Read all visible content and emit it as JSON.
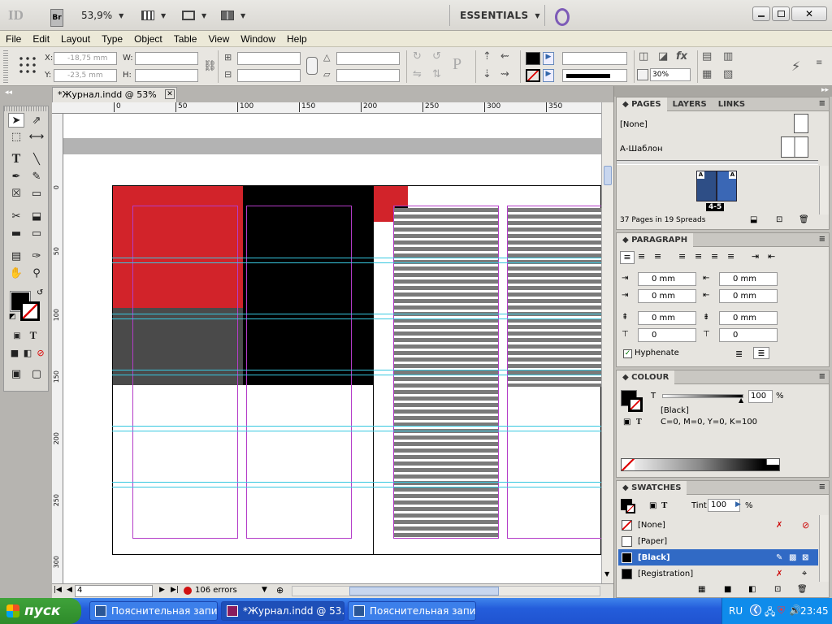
{
  "titlebar": {
    "app_logo": "ID",
    "bridge_label": "Br",
    "zoom": "53,9%",
    "workspace": "ESSENTIALS"
  },
  "menu": [
    "File",
    "Edit",
    "Layout",
    "Type",
    "Object",
    "Table",
    "View",
    "Window",
    "Help"
  ],
  "control": {
    "x_label": "X:",
    "x_value": "-18,75 mm",
    "y_label": "Y:",
    "y_value": "-23,5 mm",
    "w_label": "W:",
    "h_label": "H:",
    "stroke_percent": "30%"
  },
  "document": {
    "tab_title": "*Журнал.indd @ 53%",
    "ruler_h": [
      "0",
      "50",
      "100",
      "150",
      "200",
      "250",
      "300",
      "350"
    ],
    "ruler_v": [
      "0",
      "50",
      "100",
      "150",
      "200",
      "250",
      "300"
    ]
  },
  "status": {
    "page": "4",
    "errors": "106 errors"
  },
  "pages_panel": {
    "tabs": [
      "PAGES",
      "LAYERS",
      "LINKS"
    ],
    "master_none": "[None]",
    "master_a": "А-Шаблон",
    "spread_label": "4-5",
    "master_letter": "A",
    "summary": "37 Pages in 19 Spreads"
  },
  "paragraph_panel": {
    "title": "PARAGRAPH",
    "left_indent": "0 mm",
    "right_indent": "0 mm",
    "first_indent": "0 mm",
    "last_indent": "0 mm",
    "space_before": "0 mm",
    "space_after": "0 mm",
    "drop_lines": "0",
    "drop_chars": "0",
    "hyphenate": "Hyphenate"
  },
  "colour_panel": {
    "title": "COLOUR",
    "channel": "T",
    "tint": "100",
    "percent": "%",
    "swatch_name": "[Black]",
    "cmyk": "C=0, M=0, Y=0, K=100"
  },
  "swatches_panel": {
    "title": "SWATCHES",
    "tint_label": "Tint:",
    "tint": "100",
    "percent": "%",
    "items": [
      "[None]",
      "[Paper]",
      "[Black]",
      "[Registration]"
    ]
  },
  "taskbar": {
    "start": "пуск",
    "tasks": [
      "Пояснительная запи...",
      "*Журнал.indd @ 53...",
      "Пояснительная запи..."
    ],
    "lang": "RU",
    "time": "23:45"
  },
  "colors": {
    "red": "#d2232a",
    "black": "#000000",
    "dark_gray": "#4a4a4a",
    "guide_cyan": "#37c8e0",
    "margin_magenta": "#b43cc8",
    "selection_blue": "#316ac5"
  }
}
